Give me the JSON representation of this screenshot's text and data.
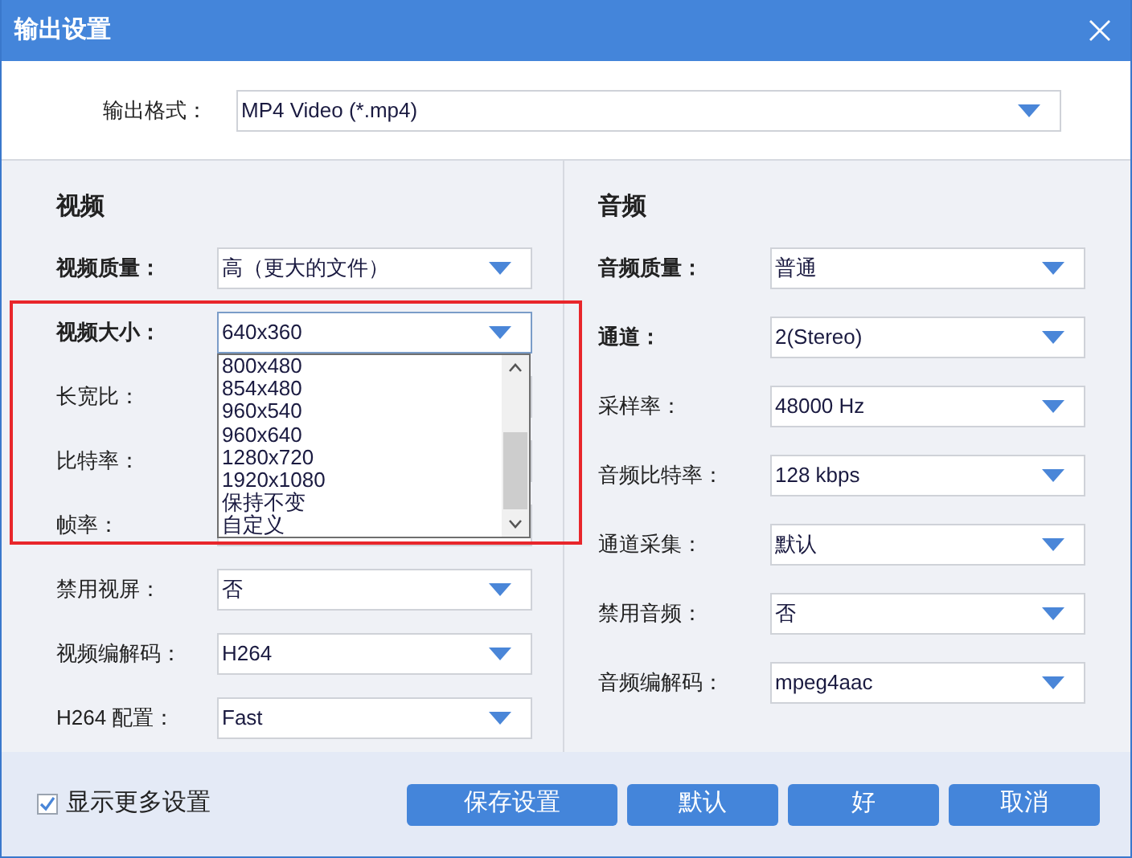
{
  "window": {
    "title": "输出设置"
  },
  "format": {
    "label": "输出格式：",
    "value": "MP4 Video (*.mp4)"
  },
  "video": {
    "heading": "视频",
    "fields": [
      {
        "label": "视频质量：",
        "value": "高（更大的文件）",
        "bold": true,
        "expanded": false
      },
      {
        "label": "视频大小：",
        "value": "640x360",
        "bold": true,
        "expanded": true,
        "options": [
          "800x480",
          "854x480",
          "960x540",
          "960x640",
          "1280x720",
          "1920x1080",
          "保持不变",
          "自定义"
        ]
      },
      {
        "label": "长宽比：",
        "bold": false,
        "expanded": false
      },
      {
        "label": "比特率：",
        "bold": false,
        "expanded": false
      },
      {
        "label": "帧率：",
        "bold": false,
        "expanded": false
      },
      {
        "label": "禁用视屏：",
        "value": "否",
        "bold": false,
        "expanded": false
      },
      {
        "label": "视频编解码：",
        "value": "H264",
        "bold": false,
        "expanded": false
      },
      {
        "label": "H264 配置：",
        "value": "Fast",
        "bold": false,
        "expanded": false
      }
    ]
  },
  "audio": {
    "heading": "音频",
    "fields": [
      {
        "label": "音频质量：",
        "value": "普通",
        "bold": true,
        "expanded": false
      },
      {
        "label": "通道：",
        "value": "2(Stereo)",
        "bold": true,
        "expanded": false
      },
      {
        "label": "采样率：",
        "value": "48000 Hz",
        "bold": false,
        "expanded": false
      },
      {
        "label": "音频比特率：",
        "value": "128 kbps",
        "bold": false,
        "expanded": false
      },
      {
        "label": "通道采集：",
        "value": "默认",
        "bold": false,
        "expanded": false
      },
      {
        "label": "禁用音频：",
        "value": "否",
        "bold": false,
        "expanded": false
      },
      {
        "label": "音频编解码：",
        "value": "mpeg4aac",
        "bold": false,
        "expanded": false
      }
    ]
  },
  "footer": {
    "checkbox": {
      "label": "显示更多设置",
      "checked": true
    },
    "buttons": [
      "保存设置",
      "默认",
      "好",
      "取消"
    ]
  }
}
